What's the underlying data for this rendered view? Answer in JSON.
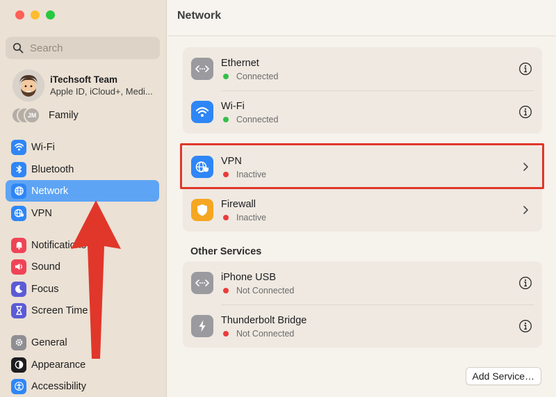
{
  "sidebar": {
    "search_placeholder": "Search",
    "account": {
      "name": "iTechsoft Team",
      "subtitle": "Apple ID, iCloud+, Medi..."
    },
    "family": {
      "label": "Family",
      "initials": "JM"
    },
    "items": [
      {
        "label": "Wi-Fi",
        "icon": "wifi-icon",
        "color": "#2f86f6"
      },
      {
        "label": "Bluetooth",
        "icon": "bluetooth-icon",
        "color": "#2f86f6"
      },
      {
        "label": "Network",
        "icon": "globe-icon",
        "color": "#2f86f6",
        "selected": true
      },
      {
        "label": "VPN",
        "icon": "vpn-globe-icon",
        "color": "#2f86f6"
      },
      {
        "label": "Notifications",
        "icon": "bell-icon",
        "color": "#ef4457"
      },
      {
        "label": "Sound",
        "icon": "speaker-icon",
        "color": "#ef4457"
      },
      {
        "label": "Focus",
        "icon": "moon-icon",
        "color": "#5b5bd6"
      },
      {
        "label": "Screen Time",
        "icon": "hourglass-icon",
        "color": "#5b5bd6"
      },
      {
        "label": "General",
        "icon": "gear-icon",
        "color": "#8e8e93"
      },
      {
        "label": "Appearance",
        "icon": "appearance-icon",
        "color": "#1d1d1f"
      },
      {
        "label": "Accessibility",
        "icon": "accessibility-icon",
        "color": "#2f86f6"
      }
    ]
  },
  "main": {
    "title": "Network",
    "services": [
      {
        "name": "Ethernet",
        "status": "Connected",
        "status_color": "green",
        "icon": "ethernet-icon",
        "action": "info-icon"
      },
      {
        "name": "Wi-Fi",
        "status": "Connected",
        "status_color": "green",
        "icon": "wifi-icon",
        "action": "info-icon"
      }
    ],
    "security": [
      {
        "name": "VPN",
        "status": "Inactive",
        "status_color": "red",
        "icon": "vpn-globe-icon",
        "action": "chevron-right-icon"
      },
      {
        "name": "Firewall",
        "status": "Inactive",
        "status_color": "red",
        "icon": "shield-icon",
        "action": "chevron-right-icon"
      }
    ],
    "other_services_title": "Other Services",
    "other_services": [
      {
        "name": "iPhone USB",
        "status": "Not Connected",
        "status_color": "red",
        "icon": "ethernet-icon",
        "action": "info-icon"
      },
      {
        "name": "Thunderbolt Bridge",
        "status": "Not Connected",
        "status_color": "red",
        "icon": "thunderbolt-icon",
        "action": "info-icon"
      }
    ],
    "add_service_label": "Add Service…"
  },
  "colors": {
    "accent": "#5ea4f4",
    "highlight_box": "#e0372a",
    "arrow": "#e0372a",
    "status_connected": "#32c04a",
    "status_inactive": "#ea3b3b"
  }
}
